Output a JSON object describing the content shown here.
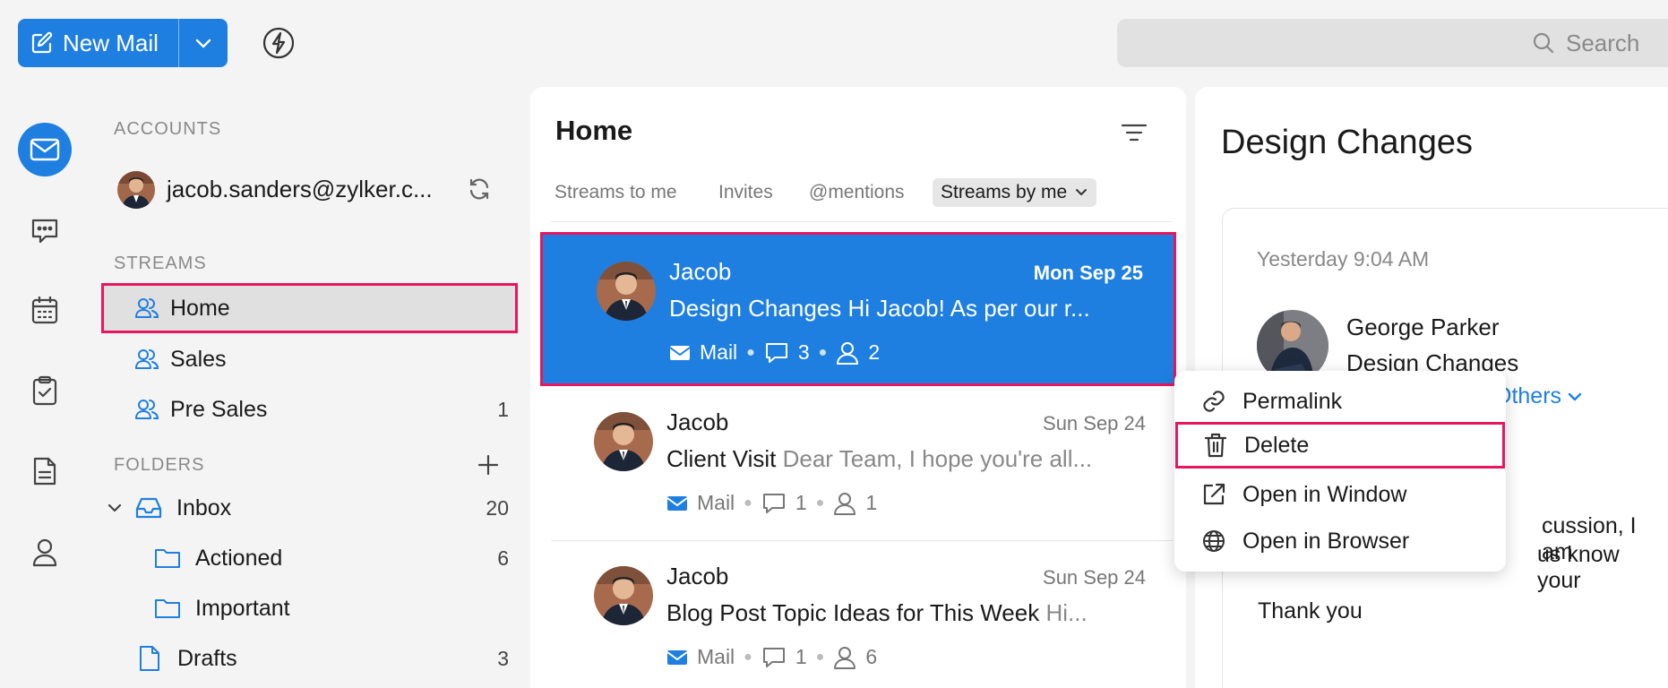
{
  "toolbar": {
    "new_mail_label": "New Mail",
    "search_placeholder": "Search"
  },
  "sidebar": {
    "accounts_title": "ACCOUNTS",
    "account_email": "jacob.sanders@zylker.c...",
    "streams_title": "STREAMS",
    "streams": [
      {
        "label": "Home",
        "count": ""
      },
      {
        "label": "Sales",
        "count": ""
      },
      {
        "label": "Pre Sales",
        "count": "1"
      }
    ],
    "folders_title": "FOLDERS",
    "folders": [
      {
        "label": "Inbox",
        "count": "20"
      },
      {
        "label": "Actioned",
        "count": "6"
      },
      {
        "label": "Important",
        "count": ""
      },
      {
        "label": "Drafts",
        "count": "3"
      }
    ]
  },
  "stream_list": {
    "title": "Home",
    "tabs": [
      "Streams to me",
      "Invites",
      "@mentions",
      "Streams by me"
    ],
    "items": [
      {
        "sender": "Jacob",
        "date": "Mon Sep 25",
        "subject": "Design Changes",
        "preview": "Hi Jacob! As per our r...",
        "type": "Mail",
        "comments": "3",
        "participants": "2"
      },
      {
        "sender": "Jacob",
        "date": "Sun Sep 24",
        "subject": "Client Visit",
        "preview": "Dear Team, I hope you're all...",
        "type": "Mail",
        "comments": "1",
        "participants": "1"
      },
      {
        "sender": "Jacob",
        "date": "Sun Sep 24",
        "subject": "Blog Post Topic Ideas for This Week",
        "preview": "Hi...",
        "type": "Mail",
        "comments": "1",
        "participants": "6"
      }
    ]
  },
  "detail": {
    "title": "Design Changes",
    "time": "Yesterday 9:04 AM",
    "sender": "George Parker",
    "subject": "Design Changes",
    "others_label": "Others",
    "body_line1": "cussion, I am",
    "body_line2": "us know your",
    "thanks": "Thank you"
  },
  "context_menu": {
    "items": [
      "Permalink",
      "Delete",
      "Open in Window",
      "Open in Browser"
    ]
  },
  "colors": {
    "accent": "#1f7fe0",
    "highlight": "#e8175d"
  }
}
